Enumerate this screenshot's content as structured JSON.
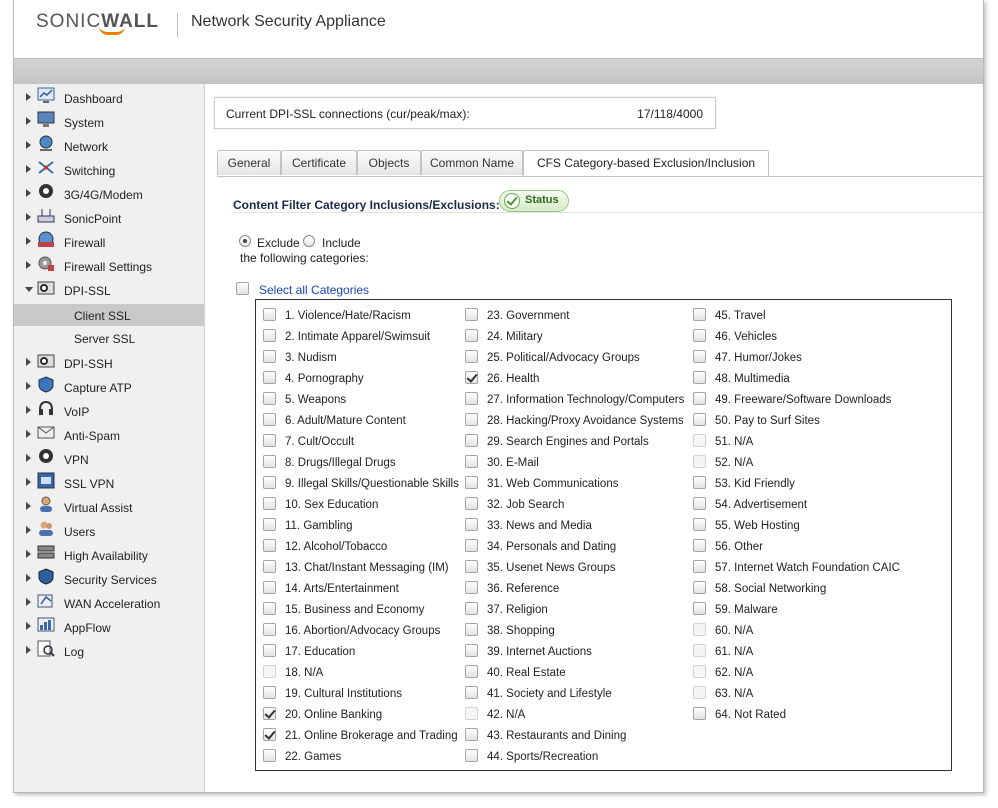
{
  "header": {
    "logo_left": "SONIC",
    "logo_right": "WALL",
    "product_title": "Network Security Appliance"
  },
  "sidebar": {
    "items": [
      {
        "label": "Dashboard",
        "icon": "dashboard-icon"
      },
      {
        "label": "System",
        "icon": "system-icon"
      },
      {
        "label": "Network",
        "icon": "network-icon"
      },
      {
        "label": "Switching",
        "icon": "switching-icon"
      },
      {
        "label": "3G/4G/Modem",
        "icon": "modem-icon"
      },
      {
        "label": "SonicPoint",
        "icon": "sonicpoint-icon"
      },
      {
        "label": "Firewall",
        "icon": "firewall-icon"
      },
      {
        "label": "Firewall Settings",
        "icon": "firewall-settings-icon"
      },
      {
        "label": "DPI-SSL",
        "icon": "dpi-ssl-icon",
        "expanded": true
      },
      {
        "label": "DPI-SSH",
        "icon": "dpi-ssh-icon"
      },
      {
        "label": "Capture ATP",
        "icon": "capture-atp-icon"
      },
      {
        "label": "VoIP",
        "icon": "voip-icon"
      },
      {
        "label": "Anti-Spam",
        "icon": "anti-spam-icon"
      },
      {
        "label": "VPN",
        "icon": "vpn-icon"
      },
      {
        "label": "SSL VPN",
        "icon": "ssl-vpn-icon"
      },
      {
        "label": "Virtual Assist",
        "icon": "virtual-assist-icon"
      },
      {
        "label": "Users",
        "icon": "users-icon"
      },
      {
        "label": "High Availability",
        "icon": "high-availability-icon"
      },
      {
        "label": "Security Services",
        "icon": "security-services-icon"
      },
      {
        "label": "WAN Acceleration",
        "icon": "wan-acceleration-icon"
      },
      {
        "label": "AppFlow",
        "icon": "appflow-icon"
      },
      {
        "label": "Log",
        "icon": "log-icon"
      }
    ],
    "subitems": [
      {
        "label": "Client SSL",
        "active": true
      },
      {
        "label": "Server SSL",
        "active": false
      }
    ]
  },
  "dpi_connections": {
    "label": "Current DPI-SSL connections (cur/peak/max):",
    "value": "17/118/4000"
  },
  "tabs": [
    {
      "label": "General",
      "active": false
    },
    {
      "label": "Certificate",
      "active": false
    },
    {
      "label": "Objects",
      "active": false
    },
    {
      "label": "Common Name",
      "active": false
    },
    {
      "label": "CFS Category-based Exclusion/Inclusion",
      "active": true
    }
  ],
  "section": {
    "title": "Content Filter Category Inclusions/Exclusions:",
    "status_label": "Status"
  },
  "mode": {
    "exclude_label": "Exclude",
    "include_label": "Include",
    "selected": "exclude",
    "suffix": "the following categories:"
  },
  "select_all_label": "Select all Categories",
  "categories": [
    {
      "label": "1. Violence/Hate/Racism",
      "checked": false,
      "disabled": false
    },
    {
      "label": "2. Intimate Apparel/Swimsuit",
      "checked": false,
      "disabled": false
    },
    {
      "label": "3. Nudism",
      "checked": false,
      "disabled": false
    },
    {
      "label": "4. Pornography",
      "checked": false,
      "disabled": false
    },
    {
      "label": "5. Weapons",
      "checked": false,
      "disabled": false
    },
    {
      "label": "6. Adult/Mature Content",
      "checked": false,
      "disabled": false
    },
    {
      "label": "7. Cult/Occult",
      "checked": false,
      "disabled": false
    },
    {
      "label": "8. Drugs/Illegal Drugs",
      "checked": false,
      "disabled": false
    },
    {
      "label": "9. Illegal Skills/Questionable Skills",
      "checked": false,
      "disabled": false
    },
    {
      "label": "10. Sex Education",
      "checked": false,
      "disabled": false
    },
    {
      "label": "11. Gambling",
      "checked": false,
      "disabled": false
    },
    {
      "label": "12. Alcohol/Tobacco",
      "checked": false,
      "disabled": false
    },
    {
      "label": "13. Chat/Instant Messaging (IM)",
      "checked": false,
      "disabled": false
    },
    {
      "label": "14. Arts/Entertainment",
      "checked": false,
      "disabled": false
    },
    {
      "label": "15. Business and Economy",
      "checked": false,
      "disabled": false
    },
    {
      "label": "16. Abortion/Advocacy Groups",
      "checked": false,
      "disabled": false
    },
    {
      "label": "17. Education",
      "checked": false,
      "disabled": false
    },
    {
      "label": "18. N/A",
      "checked": false,
      "disabled": true
    },
    {
      "label": "19. Cultural Institutions",
      "checked": false,
      "disabled": false
    },
    {
      "label": "20. Online Banking",
      "checked": true,
      "disabled": false
    },
    {
      "label": "21. Online Brokerage and Trading",
      "checked": true,
      "disabled": false
    },
    {
      "label": "22. Games",
      "checked": false,
      "disabled": false
    },
    {
      "label": "23. Government",
      "checked": false,
      "disabled": false
    },
    {
      "label": "24. Military",
      "checked": false,
      "disabled": false
    },
    {
      "label": "25. Political/Advocacy Groups",
      "checked": false,
      "disabled": false
    },
    {
      "label": "26. Health",
      "checked": true,
      "disabled": false
    },
    {
      "label": "27. Information Technology/Computers",
      "checked": false,
      "disabled": false
    },
    {
      "label": "28. Hacking/Proxy Avoidance Systems",
      "checked": false,
      "disabled": false
    },
    {
      "label": "29. Search Engines and Portals",
      "checked": false,
      "disabled": false
    },
    {
      "label": "30. E-Mail",
      "checked": false,
      "disabled": false
    },
    {
      "label": "31. Web Communications",
      "checked": false,
      "disabled": false
    },
    {
      "label": "32. Job Search",
      "checked": false,
      "disabled": false
    },
    {
      "label": "33. News and Media",
      "checked": false,
      "disabled": false
    },
    {
      "label": "34. Personals and Dating",
      "checked": false,
      "disabled": false
    },
    {
      "label": "35. Usenet News Groups",
      "checked": false,
      "disabled": false
    },
    {
      "label": "36. Reference",
      "checked": false,
      "disabled": false
    },
    {
      "label": "37. Religion",
      "checked": false,
      "disabled": false
    },
    {
      "label": "38. Shopping",
      "checked": false,
      "disabled": false
    },
    {
      "label": "39. Internet Auctions",
      "checked": false,
      "disabled": false
    },
    {
      "label": "40. Real Estate",
      "checked": false,
      "disabled": false
    },
    {
      "label": "41. Society and Lifestyle",
      "checked": false,
      "disabled": false
    },
    {
      "label": "42. N/A",
      "checked": false,
      "disabled": true
    },
    {
      "label": "43. Restaurants and Dining",
      "checked": false,
      "disabled": false
    },
    {
      "label": "44. Sports/Recreation",
      "checked": false,
      "disabled": false
    },
    {
      "label": "45. Travel",
      "checked": false,
      "disabled": false
    },
    {
      "label": "46. Vehicles",
      "checked": false,
      "disabled": false
    },
    {
      "label": "47. Humor/Jokes",
      "checked": false,
      "disabled": false
    },
    {
      "label": "48. Multimedia",
      "checked": false,
      "disabled": false
    },
    {
      "label": "49. Freeware/Software Downloads",
      "checked": false,
      "disabled": false
    },
    {
      "label": "50. Pay to Surf Sites",
      "checked": false,
      "disabled": false
    },
    {
      "label": "51. N/A",
      "checked": false,
      "disabled": true
    },
    {
      "label": "52. N/A",
      "checked": false,
      "disabled": true
    },
    {
      "label": "53. Kid Friendly",
      "checked": false,
      "disabled": false
    },
    {
      "label": "54. Advertisement",
      "checked": false,
      "disabled": false
    },
    {
      "label": "55. Web Hosting",
      "checked": false,
      "disabled": false
    },
    {
      "label": "56. Other",
      "checked": false,
      "disabled": false
    },
    {
      "label": "57. Internet Watch Foundation CAIC",
      "checked": false,
      "disabled": false
    },
    {
      "label": "58. Social Networking",
      "checked": false,
      "disabled": false
    },
    {
      "label": "59. Malware",
      "checked": false,
      "disabled": false
    },
    {
      "label": "60. N/A",
      "checked": false,
      "disabled": true
    },
    {
      "label": "61. N/A",
      "checked": false,
      "disabled": true
    },
    {
      "label": "62. N/A",
      "checked": false,
      "disabled": true
    },
    {
      "label": "63. N/A",
      "checked": false,
      "disabled": true
    },
    {
      "label": "64. Not Rated",
      "checked": false,
      "disabled": false
    }
  ],
  "colors": {
    "brand_orange": "#f07c00",
    "link_blue": "#1845b8",
    "status_green": "#336a21",
    "active_nav": "#c9c9c9"
  }
}
